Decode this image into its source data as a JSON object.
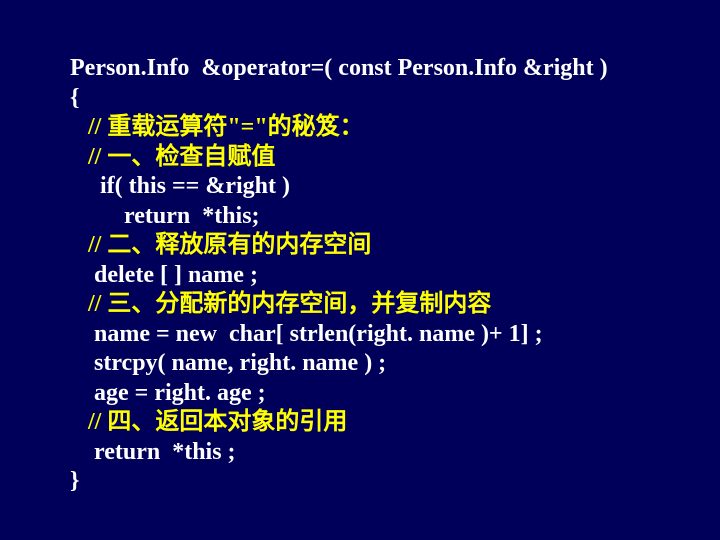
{
  "code": {
    "l1": "Person.Info  &operator=( const Person.Info &right )",
    "l2": "{",
    "l3": "   // 重载运算符\"=\"的秘笈：",
    "l4": "   // 一、检查自赋值",
    "l5": "     if( this == &right )",
    "l6": "         return  *this;",
    "l7": "   // 二、释放原有的内存空间",
    "l8": "    delete [ ] name ;",
    "l9": "   // 三、分配新的内存空间，并复制内容",
    "l10": "    name = new  char[ strlen(right. name )+ 1] ;",
    "l11": "    strcpy( name, right. name ) ;",
    "l12": "    age = right. age ;",
    "l13": "   // 四、返回本对象的引用",
    "l14": "    return  *this ;",
    "l15": "}"
  }
}
